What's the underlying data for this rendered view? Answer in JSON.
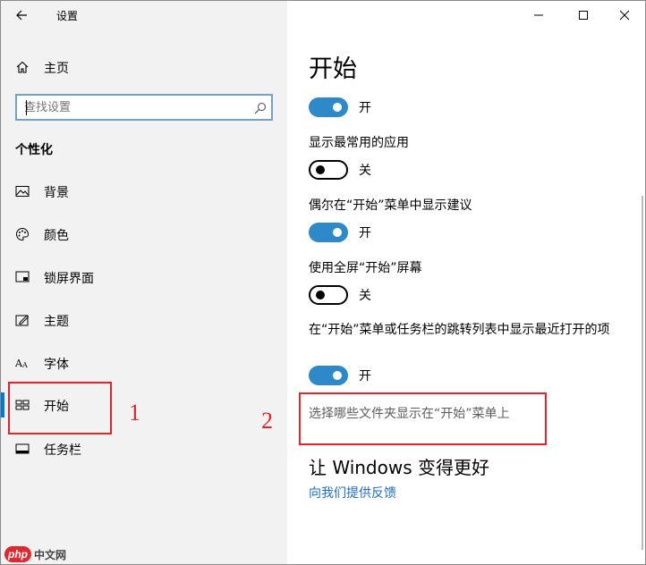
{
  "app": {
    "title": "设置"
  },
  "sidebar": {
    "home_label": "主页",
    "search_placeholder": "查找设置",
    "section_title": "个性化",
    "items": [
      {
        "label": "背景",
        "icon": "picture-icon"
      },
      {
        "label": "颜色",
        "icon": "palette-icon"
      },
      {
        "label": "锁屏界面",
        "icon": "lock-screen-icon"
      },
      {
        "label": "主题",
        "icon": "theme-icon"
      },
      {
        "label": "字体",
        "icon": "font-icon"
      },
      {
        "label": "开始",
        "icon": "start-icon",
        "active": true
      },
      {
        "label": "任务栏",
        "icon": "taskbar-icon"
      }
    ]
  },
  "annotations": {
    "mark1": "1",
    "mark2": "2"
  },
  "main": {
    "page_title": "开始",
    "settings": [
      {
        "label": "",
        "state": "开",
        "on": true
      },
      {
        "label": "显示最常用的应用",
        "state": "关",
        "on": false
      },
      {
        "label": "偶尔在“开始”菜单中显示建议",
        "state": "开",
        "on": true
      },
      {
        "label": "使用全屏“开始”屏幕",
        "state": "关",
        "on": false
      },
      {
        "label": "在“开始”菜单或任务栏的跳转列表中显示最近打开的项",
        "state": "开",
        "on": true
      }
    ],
    "folders_link": "选择哪些文件夹显示在“开始”菜单上",
    "improve_title": "让 Windows 变得更好",
    "feedback_link": "向我们提供反馈"
  },
  "watermark": {
    "logo": "php",
    "text": "中文网"
  },
  "colors": {
    "accent": "#0078d7",
    "toggle_on": "#2d89c8",
    "annotation": "#e8222a"
  }
}
